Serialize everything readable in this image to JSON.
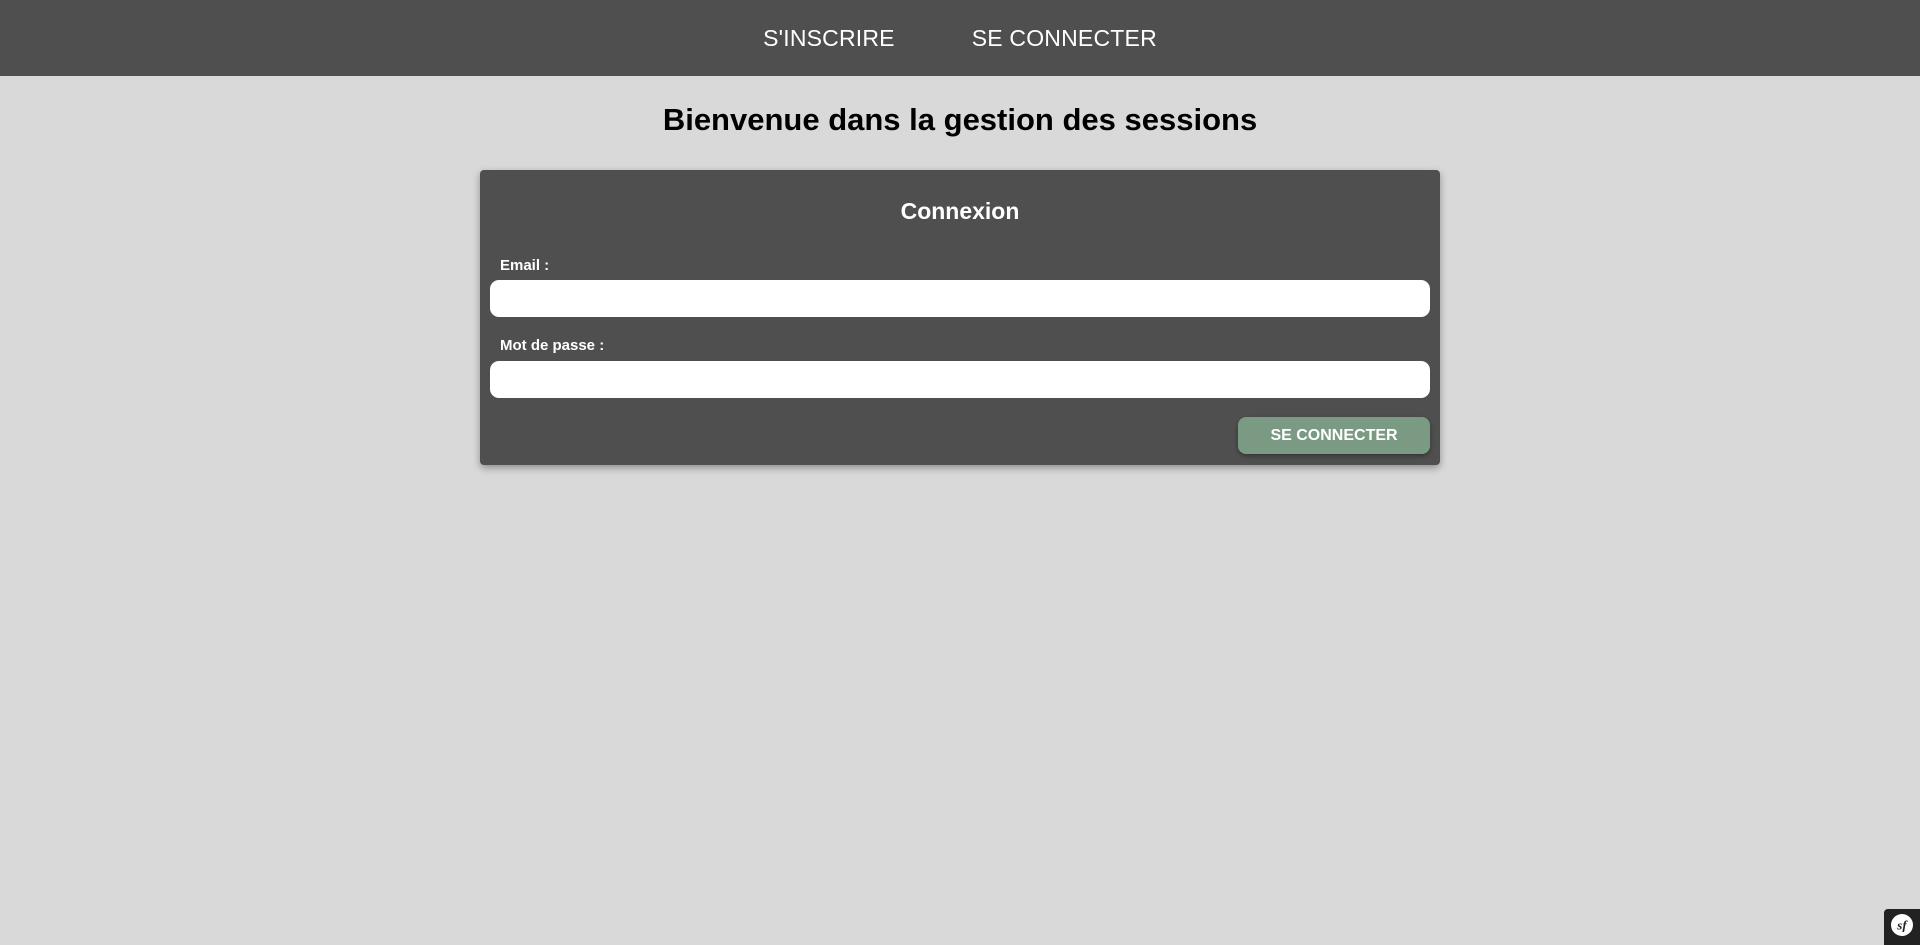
{
  "nav": {
    "items": [
      {
        "label": "S'INSCRIRE"
      },
      {
        "label": "SE CONNECTER"
      }
    ]
  },
  "page": {
    "title": "Bienvenue dans la gestion des sessions"
  },
  "login_form": {
    "title": "Connexion",
    "email_label": "Email :",
    "email_value": "",
    "password_label": "Mot de passe :",
    "password_value": "",
    "submit_label": "SE CONNECTER"
  },
  "debug_toolbar": {
    "icon": "symfony-logo-icon"
  },
  "colors": {
    "nav_background": "#4f4f4f",
    "page_background": "#d9d9d9",
    "card_background": "#4f4f4f",
    "button_background": "#7a9a84"
  }
}
